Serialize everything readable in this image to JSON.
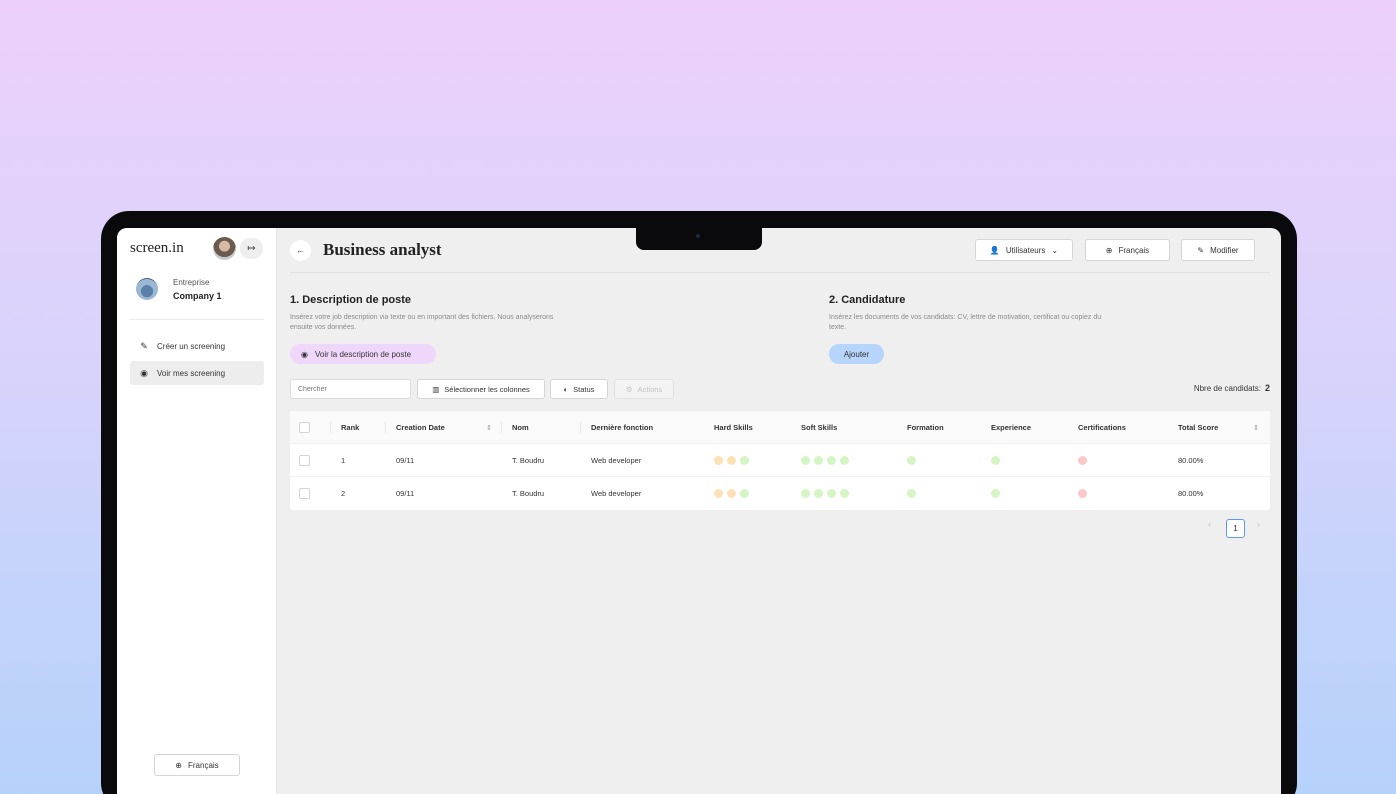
{
  "sidebar": {
    "logo": "screen.in",
    "company_label": "Entreprise",
    "company_name": "Company 1",
    "nav": [
      {
        "label": "Créer un screening",
        "icon": "edit-icon"
      },
      {
        "label": "Voir mes screening",
        "icon": "eye-icon",
        "active": true
      }
    ],
    "language": "Français"
  },
  "header": {
    "title": "Business analyst",
    "users_label": "Utilisateurs",
    "language_label": "Français",
    "edit_label": "Modifier"
  },
  "section1": {
    "title": "1. Description de poste",
    "desc_line1": "Insérez votre job description via texte ou en important des fichiers. Nous analyserons",
    "desc_line2": "ensuite vos données.",
    "button": "Voir la description de poste"
  },
  "section2": {
    "title": "2. Candidature",
    "desc_line1": "Insérez les documents de vos candidats: CV, lettre de motivation, certificat ou copiez du",
    "desc_line2": "texte.",
    "button": "Ajouter"
  },
  "toolbar": {
    "search_placeholder": "Chercher",
    "select_columns": "Sélectionner les colonnes",
    "status": "Status",
    "actions": "Actions",
    "count_label": "Nbre de candidats:",
    "count_value": "2"
  },
  "table": {
    "columns": [
      "Rank",
      "Creation Date",
      "Nom",
      "Dernière fonction",
      "Hard Skills",
      "Soft Skills",
      "Formation",
      "Experience",
      "Certifications",
      "Total Score"
    ],
    "rows": [
      {
        "rank": "1",
        "date": "09/11",
        "nom": "T. Boudru",
        "fonction": "Web developer",
        "score": "80.00%"
      },
      {
        "rank": "2",
        "date": "09/11",
        "nom": "T. Boudru",
        "fonction": "Web developer",
        "score": "80.00%"
      }
    ],
    "colors": {
      "orange": "#fde0b4",
      "green": "#d5f5c4",
      "red": "#fbc7c7"
    }
  },
  "pagination": {
    "current": "1",
    "prev": "‹",
    "next": "›"
  }
}
